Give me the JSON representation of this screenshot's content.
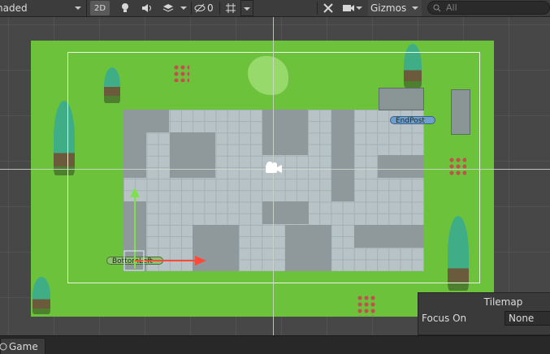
{
  "toolbar": {
    "shading_label": "haded",
    "mode_2d_label": "2D",
    "hidden_count": "0",
    "gizmos_label": "Gizmos",
    "search_placeholder": "All"
  },
  "scene": {
    "end_label": "EndPost",
    "start_label": "BottomLeft"
  },
  "overlay": {
    "title": "Tilemap",
    "focus_label": "Focus On",
    "focus_value": "None"
  },
  "tabs": {
    "game_label": "Game"
  },
  "colors": {
    "grass": "#6dc23c",
    "tile_light": "#b7c3c6",
    "tile_dark": "#8f999c",
    "scene_bg": "#474747"
  }
}
